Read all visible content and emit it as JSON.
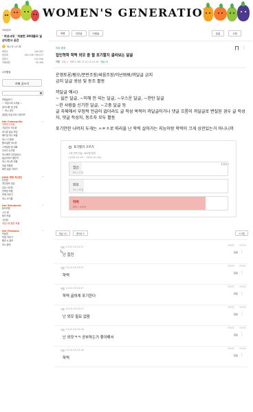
{
  "banner": {
    "title": "WOMEN'S GENERATION"
  },
  "sidebar": {
    "cafe_label": "카페정보",
    "cafe_title": "' 여성시대 ' 차분한 20대들의 일상다반사 공간",
    "member_label": "매니저 L4기록",
    "stats": [
      {
        "label": "회원수",
        "value": "164,583"
      },
      {
        "label": "동호회",
        "value": "964,336  798,073"
      },
      {
        "label": "방문자",
        "value": "232,936"
      },
      {
        "label": "카페회원",
        "value": "90,388"
      }
    ],
    "myinfo_label": "나의활동",
    "write_label": "카페 글쓰기",
    "list_items": [
      {
        "label": "전체글보기",
        "style": "normal"
      },
      {
        "label": "☆ 여성시대 소개글 ☆",
        "style": "normal"
      },
      {
        "label": "공지사항 및 규정",
        "style": "normal"
      },
      {
        "label": "♡ 여시 공지",
        "style": "normal"
      },
      {
        "label": "[등업] 여성시대 스테이즈",
        "style": "normal"
      }
    ],
    "sections": [
      {
        "title": "Her Community",
        "items": [
          "지피쳐 수다방",
          "가입인사 여시방",
          "여시방 일상 모임",
          "애드빌 여시 모음",
          "여시 다 함께",
          "웹소설방 여시방",
          "스케일링 및 대화",
          "이야기 수다방",
          "여시에게 고민상담소",
          "일상이야기 빨간거",
          "여시 게시판 모음",
          "덧글 모음방",
          "애견 일상 이야기"
        ]
      },
      {
        "title": "[ADS 제재 게시판]",
        "items": [
          "논란방",
          "개인정보 공유",
          "감성 사진방",
          "친목방 모음",
          "연애 이야기",
          "여시 소식통"
        ]
      },
      {
        "title": "Her Standards",
        "items": [
          "동아리방",
          "시사 방",
          "정치 토론",
          "사진방",
          "여성시대 발전 모음"
        ]
      },
      {
        "title": "Her Passions",
        "items": [
          "덕질방",
          "덕질 이야기",
          "패션 & 뷰티",
          "여시 음악"
        ]
      }
    ]
  },
  "topbar": {
    "buttons": [
      "목록",
      "이전글",
      "다음글"
    ],
    "right_buttons": [
      "답글",
      "수정"
    ]
  },
  "post": {
    "board": "자유 발표",
    "title": "집인혁학 학력 외모 중 뭘 포기할지 골라보는 달글",
    "meta": {
      "author": "익명",
      "level": "우유 4",
      "date": "조회 1,361  21.01.19 22:16",
      "comments": "댓글 43"
    },
    "body": [
      "운영토론/펌오/분란조장/싸움조장/이넌봐봐/까달글 금지",
      "금지 달글 생성 및 동조 활동",
      "",
      "까달글 예시)",
      "~ 싫은 달글, ~이해 안 되는 달글, ~우스운 달글, ~한탄 달글",
      "~한 사람들 신기한 달글, ~고충 달글 등",
      "글 자체에서 부정적 언급이 없더라도 글 작성 목적이 까달글이거나 댓글 흐름이 까달글로 변질된 경우 글 작성자, 댓글 작성자, 동조자 모두 활동",
      "",
      "포기안한 나머지 두개는 ㅅㅌㅊ로 따라올 난 학력 살아가는 지능이랑 학력이 크게 상관있는거 아니니까"
    ]
  },
  "vote": {
    "heading": "포기할거 고르기",
    "subtitle": "1개 선택 가능, 462명 참여",
    "date_range": "(2021-01-19 ~ 2021-01-30)",
    "action": "투표하기",
    "options": [
      {
        "label": "집인",
        "detail": "8% / 17표",
        "percent": 8,
        "winner": false
      },
      {
        "label": "외모",
        "detail": "9% / 45표",
        "percent": 9,
        "winner": false
      },
      {
        "label": "학력",
        "detail": "86% / 400표",
        "percent": 86,
        "winner": true
      }
    ]
  },
  "footer": {
    "comment_label": "댓글",
    "comment_count": "43",
    "like_label": "좋아요 5",
    "share_label": "스크랩"
  },
  "comments": [
    {
      "label": "익명",
      "time": "21.01.19 22:17",
      "text": "난 집인",
      "reply": "답글"
    },
    {
      "label": "익명",
      "time": "21.01.19 22:17",
      "text": "학력",
      "reply": "답글"
    },
    {
      "label": "익명",
      "time": "21.01.19 22:17",
      "text": "학력 골하게 포기한다",
      "reply": "답글"
    },
    {
      "label": "익명",
      "time": "21.01.19 22:17",
      "text": "난 외모 필요 없음",
      "reply": "답글"
    },
    {
      "label": "익명",
      "time": "21.01.19 22:18",
      "text": "난 외모ㅋㅋ 공부하는거 좋아해서",
      "reply": "답글"
    },
    {
      "label": "익명",
      "time": "21.01.19 22:18",
      "text": "학력",
      "reply": "답글"
    }
  ]
}
